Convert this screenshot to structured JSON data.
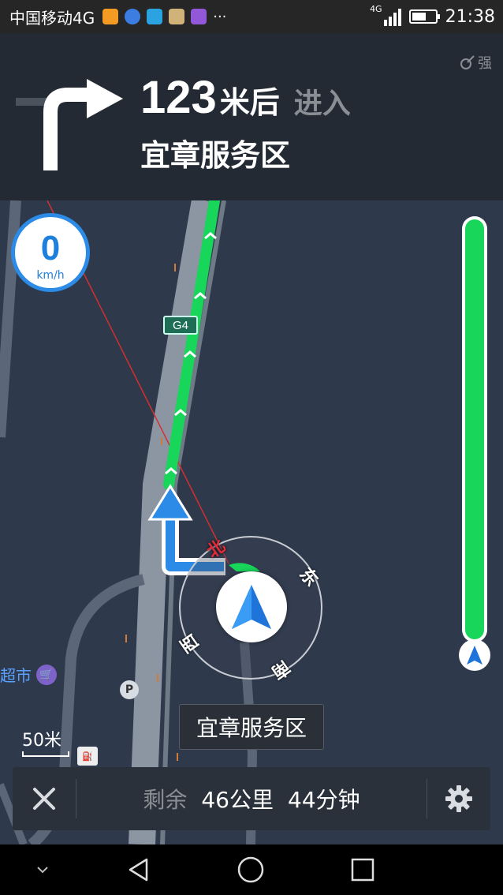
{
  "status_bar": {
    "carrier": "中国移动4G",
    "network": "4G",
    "time": "21:38",
    "more": "···"
  },
  "nav_header": {
    "distance_value": "123",
    "distance_unit": "米后",
    "action": "进入",
    "road_name": "宜章服务区",
    "gps_strength": "强"
  },
  "map": {
    "speed_value": "0",
    "speed_unit": "km/h",
    "highway_shield": "G4",
    "poi_supermarket": "超市",
    "scale_label": "50米",
    "destination_label": "宜章服务区",
    "compass": {
      "north": "北",
      "east": "东",
      "south": "南",
      "west": "西"
    },
    "route_progress": 1.0
  },
  "bottom_bar": {
    "remaining_label": "剩余",
    "remaining_distance": "46公里",
    "remaining_time": "44分钟"
  },
  "colors": {
    "route_green": "#18d65a",
    "accent_blue": "#2b8be6",
    "map_bg": "#2e3a4c",
    "header_bg": "#242a33",
    "north_red": "#e52b3a"
  },
  "icons": {
    "close": "close-icon",
    "settings": "gear-icon",
    "back": "back-triangle-icon",
    "home": "home-circle-icon",
    "recents": "recents-square-icon"
  }
}
